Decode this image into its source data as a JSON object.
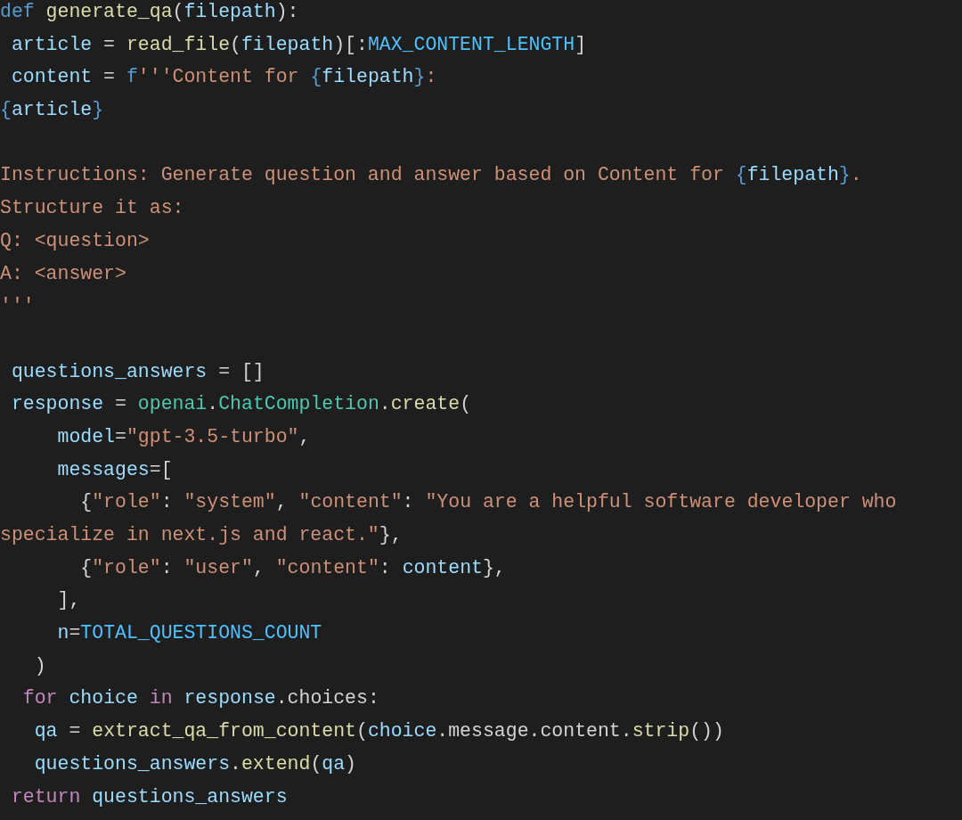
{
  "code_lines": [
    {
      "kind": "code",
      "tokens": [
        {
          "kind": "kw",
          "text": "def "
        },
        {
          "kind": "fn",
          "text": "generate_qa"
        },
        {
          "kind": "p",
          "text": "("
        },
        {
          "kind": "var",
          "text": "filepath"
        },
        {
          "kind": "p",
          "text": "):"
        }
      ]
    },
    {
      "kind": "code",
      "tokens": [
        {
          "kind": "var",
          "text": " article"
        },
        {
          "kind": "p",
          "text": " = "
        },
        {
          "kind": "fn",
          "text": "read_file"
        },
        {
          "kind": "p",
          "text": "("
        },
        {
          "kind": "var",
          "text": "filepath"
        },
        {
          "kind": "p",
          "text": ")[:"
        },
        {
          "kind": "const",
          "text": "MAX_CONTENT_LENGTH"
        },
        {
          "kind": "p",
          "text": "]"
        }
      ]
    },
    {
      "kind": "code",
      "tokens": [
        {
          "kind": "var",
          "text": " content"
        },
        {
          "kind": "p",
          "text": " = "
        },
        {
          "kind": "kw",
          "text": "f"
        },
        {
          "kind": "str",
          "text": "'''Content for "
        },
        {
          "kind": "kw",
          "text": "{"
        },
        {
          "kind": "var",
          "text": "filepath"
        },
        {
          "kind": "kw",
          "text": "}"
        },
        {
          "kind": "str",
          "text": ":"
        }
      ]
    },
    {
      "kind": "code",
      "tokens": [
        {
          "kind": "kw",
          "text": "{"
        },
        {
          "kind": "var",
          "text": "article"
        },
        {
          "kind": "kw",
          "text": "}"
        }
      ]
    },
    {
      "kind": "blank"
    },
    {
      "kind": "code",
      "tokens": [
        {
          "kind": "str",
          "text": "Instructions: Generate question and answer based on Content for "
        },
        {
          "kind": "kw",
          "text": "{"
        },
        {
          "kind": "var",
          "text": "filepath"
        },
        {
          "kind": "kw",
          "text": "}"
        },
        {
          "kind": "str",
          "text": "."
        }
      ]
    },
    {
      "kind": "code",
      "tokens": [
        {
          "kind": "str",
          "text": "Structure it as:"
        }
      ]
    },
    {
      "kind": "code",
      "tokens": [
        {
          "kind": "str",
          "text": "Q: <question>"
        }
      ]
    },
    {
      "kind": "code",
      "tokens": [
        {
          "kind": "str",
          "text": "A: <answer>"
        }
      ]
    },
    {
      "kind": "code",
      "tokens": [
        {
          "kind": "str",
          "text": "'''"
        }
      ]
    },
    {
      "kind": "blank"
    },
    {
      "kind": "code",
      "tokens": [
        {
          "kind": "var",
          "text": " questions_answers"
        },
        {
          "kind": "p",
          "text": " = []"
        }
      ]
    },
    {
      "kind": "code",
      "tokens": [
        {
          "kind": "var",
          "text": " response"
        },
        {
          "kind": "p",
          "text": " = "
        },
        {
          "kind": "cls",
          "text": "openai"
        },
        {
          "kind": "p",
          "text": "."
        },
        {
          "kind": "cls",
          "text": "ChatCompletion"
        },
        {
          "kind": "p",
          "text": "."
        },
        {
          "kind": "fn",
          "text": "create"
        },
        {
          "kind": "p",
          "text": "("
        }
      ]
    },
    {
      "kind": "code",
      "tokens": [
        {
          "kind": "var",
          "text": "     model"
        },
        {
          "kind": "p",
          "text": "="
        },
        {
          "kind": "str",
          "text": "\"gpt-3.5-turbo\""
        },
        {
          "kind": "p",
          "text": ","
        }
      ]
    },
    {
      "kind": "code",
      "tokens": [
        {
          "kind": "var",
          "text": "     messages"
        },
        {
          "kind": "p",
          "text": "=["
        }
      ]
    },
    {
      "kind": "code",
      "tokens": [
        {
          "kind": "p",
          "text": "       {"
        },
        {
          "kind": "str",
          "text": "\"role\""
        },
        {
          "kind": "p",
          "text": ": "
        },
        {
          "kind": "str",
          "text": "\"system\""
        },
        {
          "kind": "p",
          "text": ", "
        },
        {
          "kind": "str",
          "text": "\"content\""
        },
        {
          "kind": "p",
          "text": ": "
        },
        {
          "kind": "str",
          "text": "\"You are a helpful software developer who"
        }
      ]
    },
    {
      "kind": "code",
      "tokens": [
        {
          "kind": "str",
          "text": "specialize in next.js and react.\""
        },
        {
          "kind": "p",
          "text": "},"
        }
      ]
    },
    {
      "kind": "code",
      "tokens": [
        {
          "kind": "p",
          "text": "       {"
        },
        {
          "kind": "str",
          "text": "\"role\""
        },
        {
          "kind": "p",
          "text": ": "
        },
        {
          "kind": "str",
          "text": "\"user\""
        },
        {
          "kind": "p",
          "text": ", "
        },
        {
          "kind": "str",
          "text": "\"content\""
        },
        {
          "kind": "p",
          "text": ": "
        },
        {
          "kind": "var",
          "text": "content"
        },
        {
          "kind": "p",
          "text": "},"
        }
      ]
    },
    {
      "kind": "code",
      "tokens": [
        {
          "kind": "p",
          "text": "     ],"
        }
      ]
    },
    {
      "kind": "code",
      "tokens": [
        {
          "kind": "var",
          "text": "     n"
        },
        {
          "kind": "p",
          "text": "="
        },
        {
          "kind": "const",
          "text": "TOTAL_QUESTIONS_COUNT"
        }
      ]
    },
    {
      "kind": "code",
      "tokens": [
        {
          "kind": "p",
          "text": "   )"
        }
      ]
    },
    {
      "kind": "code",
      "tokens": [
        {
          "kind": "ctl",
          "text": "  for "
        },
        {
          "kind": "var",
          "text": "choice "
        },
        {
          "kind": "ctl",
          "text": "in "
        },
        {
          "kind": "var",
          "text": "response"
        },
        {
          "kind": "p",
          "text": ".choices:"
        }
      ]
    },
    {
      "kind": "code",
      "tokens": [
        {
          "kind": "var",
          "text": "   qa"
        },
        {
          "kind": "p",
          "text": " = "
        },
        {
          "kind": "fn",
          "text": "extract_qa_from_content"
        },
        {
          "kind": "p",
          "text": "("
        },
        {
          "kind": "var",
          "text": "choice"
        },
        {
          "kind": "p",
          "text": ".message.content."
        },
        {
          "kind": "fn",
          "text": "strip"
        },
        {
          "kind": "p",
          "text": "())"
        }
      ]
    },
    {
      "kind": "code",
      "tokens": [
        {
          "kind": "var",
          "text": "   questions_answers"
        },
        {
          "kind": "p",
          "text": "."
        },
        {
          "kind": "fn",
          "text": "extend"
        },
        {
          "kind": "p",
          "text": "("
        },
        {
          "kind": "var",
          "text": "qa"
        },
        {
          "kind": "p",
          "text": ")"
        }
      ]
    },
    {
      "kind": "code",
      "tokens": [
        {
          "kind": "ctl",
          "text": " return "
        },
        {
          "kind": "var",
          "text": "questions_answers"
        }
      ]
    }
  ]
}
